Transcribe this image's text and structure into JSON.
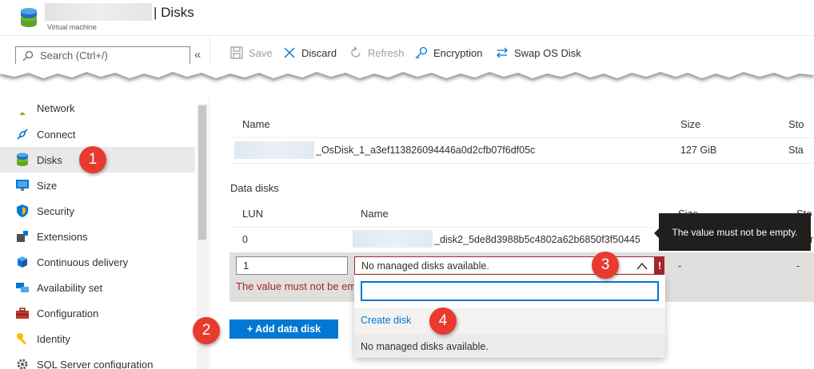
{
  "header": {
    "title": "| Disks",
    "subtitle": "Virtual machine"
  },
  "search": {
    "placeholder": "Search (Ctrl+/)",
    "collapse_glyph": "«"
  },
  "toolbar": {
    "save": "Save",
    "discard": "Discard",
    "refresh": "Refresh",
    "encryption": "Encryption",
    "swap_os_disk": "Swap OS Disk"
  },
  "sidebar": {
    "items": [
      {
        "label": "Network",
        "icon": "network-icon"
      },
      {
        "label": "Connect",
        "icon": "connect-icon"
      },
      {
        "label": "Disks",
        "icon": "disks-icon",
        "active": true
      },
      {
        "label": "Size",
        "icon": "size-icon"
      },
      {
        "label": "Security",
        "icon": "shield-icon"
      },
      {
        "label": "Extensions",
        "icon": "extensions-icon"
      },
      {
        "label": "Continuous delivery",
        "icon": "continuous-delivery-icon"
      },
      {
        "label": "Availability set",
        "icon": "availability-set-icon"
      },
      {
        "label": "Configuration",
        "icon": "toolbox-icon"
      },
      {
        "label": "Identity",
        "icon": "key-icon"
      },
      {
        "label": "SQL Server configuration",
        "icon": "gear-icon"
      }
    ]
  },
  "os_disk": {
    "headers": {
      "name": "Name",
      "size": "Size",
      "storage": "Sto"
    },
    "row": {
      "name": "_OsDisk_1_a3ef113826094446a0d2cfb07f6df05c",
      "size": "127 GiB",
      "storage": "Sta"
    }
  },
  "data_disks": {
    "section_label": "Data disks",
    "headers": {
      "lun": "LUN",
      "name": "Name",
      "size": "Size",
      "storage": "Sto"
    },
    "rows": [
      {
        "lun": "0",
        "name": "_disk2_5de8d3988b5c4802a62b6850f3f50445",
        "storage": "r"
      }
    ],
    "edit_row": {
      "lun_value": "1",
      "error_text": "The value must not be empty.",
      "dropdown_value": "No managed disks available.",
      "size": "-",
      "storage": "-"
    }
  },
  "tooltip": {
    "text": "The value must not be empty."
  },
  "dropdown_panel": {
    "search_value": "",
    "create_disk": "Create disk",
    "empty_option": "No managed disks available."
  },
  "add_button": "+ Add data disk",
  "badges": [
    "1",
    "2",
    "3",
    "4"
  ],
  "colors": {
    "accent": "#0078d4",
    "error": "#a4262c",
    "badge": "#e83a2e"
  }
}
